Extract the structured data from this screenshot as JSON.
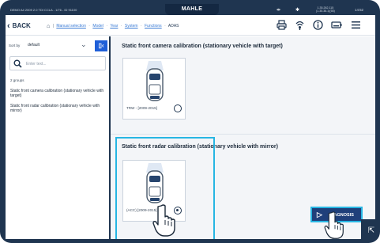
{
  "status_bar": {
    "device_text": "DEMO A4 2009 2.0 TDI CCLA - 1/76 - ID 91100",
    "brand": "MAHLE",
    "ip_lines": [
      "1.35.262.115",
      "(1.35.36.1)(55)"
    ],
    "time": "14:52"
  },
  "nav": {
    "back_label": "BACK",
    "breadcrumb": [
      {
        "label": "Manual selection",
        "link": true
      },
      {
        "label": "Model",
        "link": true
      },
      {
        "label": "Year",
        "link": true
      },
      {
        "label": "System",
        "link": true
      },
      {
        "label": "Functions",
        "link": true
      },
      {
        "label": "ADAS",
        "link": false
      }
    ],
    "icons": [
      "printer-icon",
      "signal-icon",
      "info-icon",
      "battery-icon",
      "menu-icon"
    ]
  },
  "sidebar": {
    "sort_label": "Sort by",
    "sort_value": "default",
    "search_placeholder": "Enter text...",
    "groups_count": "2 groups",
    "items": [
      {
        "label": "Static front camera calibration (stationary vehicle with target)"
      },
      {
        "label": "Static front radar calibration (stationary vehicle with mirror)"
      }
    ]
  },
  "sections": [
    {
      "title": "Static front camera calibration (stationary vehicle with target)",
      "card": {
        "caption": "TRW - [2009-2015]",
        "selected": false
      }
    },
    {
      "title": "Static front radar calibration (stationary vehicle with mirror)",
      "card": {
        "caption": "(ACC) [2009-2015]",
        "selected": true
      }
    }
  ],
  "diagnosis_button": {
    "label": "DIAGNOSIS"
  },
  "colors": {
    "frame": "#1f3550",
    "accent": "#1f5fd8",
    "highlight": "#27b6e3",
    "button": "#1f3f7a"
  }
}
